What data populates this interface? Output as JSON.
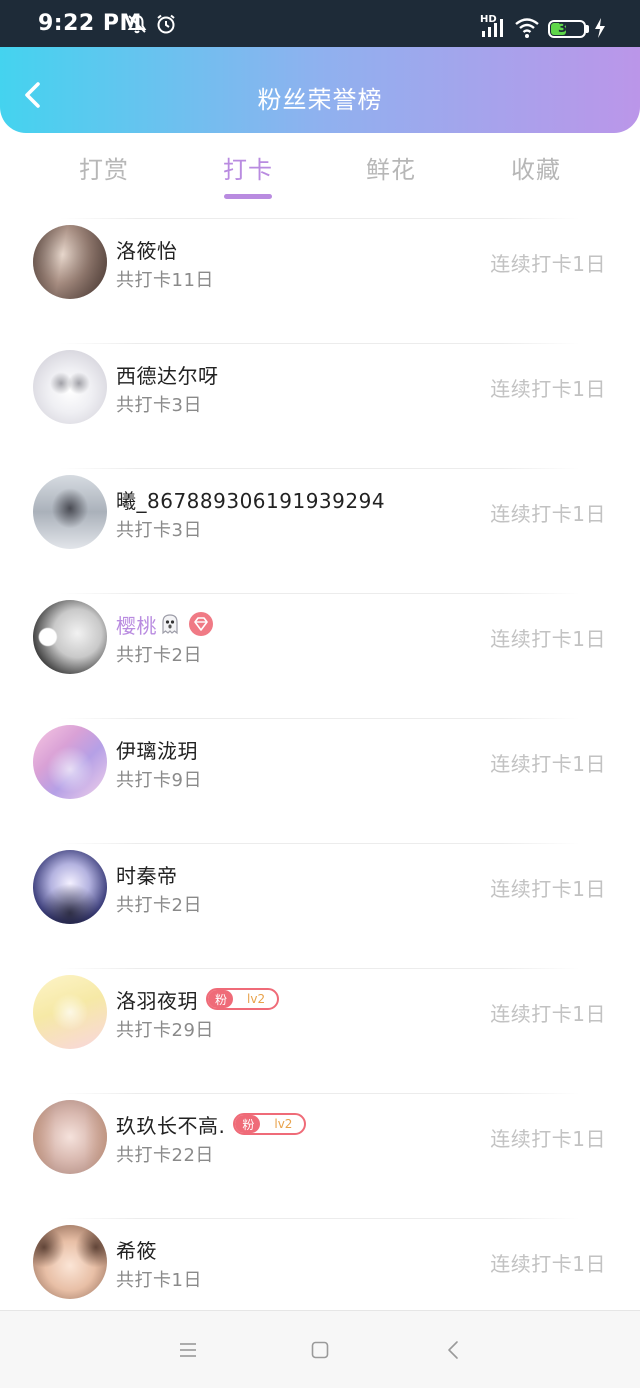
{
  "status_bar": {
    "time": "9:22 PM",
    "battery": "34",
    "network_label": "HD",
    "icons": [
      "mute-icon",
      "alarm-icon",
      "signal-icon",
      "wifi-icon",
      "battery-icon",
      "charging-icon"
    ]
  },
  "header": {
    "title": "粉丝荣誉榜",
    "back_icon": "chevron-left-icon"
  },
  "tabs": [
    {
      "label": "打赏",
      "active": false
    },
    {
      "label": "打卡",
      "active": true
    },
    {
      "label": "鲜花",
      "active": false
    },
    {
      "label": "收藏",
      "active": false
    }
  ],
  "accent_color": "#b98be0",
  "list": [
    {
      "name": "洛筱怡",
      "sub": "共打卡11日",
      "right": "连续打卡1日"
    },
    {
      "name": "西德达尔呀",
      "sub": "共打卡3日",
      "right": "连续打卡1日"
    },
    {
      "name": "曦_867889306191939294",
      "sub": "共打卡3日",
      "right": "连续打卡1日"
    },
    {
      "name": "樱桃",
      "sub": "共打卡2日",
      "right": "连续打卡1日",
      "vip": true
    },
    {
      "name": "伊璃泷玥",
      "sub": "共打卡9日",
      "right": "连续打卡1日"
    },
    {
      "name": "时秦帝",
      "sub": "共打卡2日",
      "right": "连续打卡1日"
    },
    {
      "name": "洛羽夜玥",
      "sub": "共打卡29日",
      "right": "连续打卡1日",
      "badge": {
        "label": "粉",
        "level": "lv2"
      }
    },
    {
      "name": "玖玖长不高.",
      "sub": "共打卡22日",
      "right": "连续打卡1日",
      "badge": {
        "label": "粉",
        "level": "lv2"
      }
    },
    {
      "name": "希筱",
      "sub": "共打卡1日",
      "right": "连续打卡1日"
    }
  ],
  "nav_bar": {
    "icons": [
      "menu-icon",
      "home-square-icon",
      "back-triangle-icon"
    ]
  }
}
